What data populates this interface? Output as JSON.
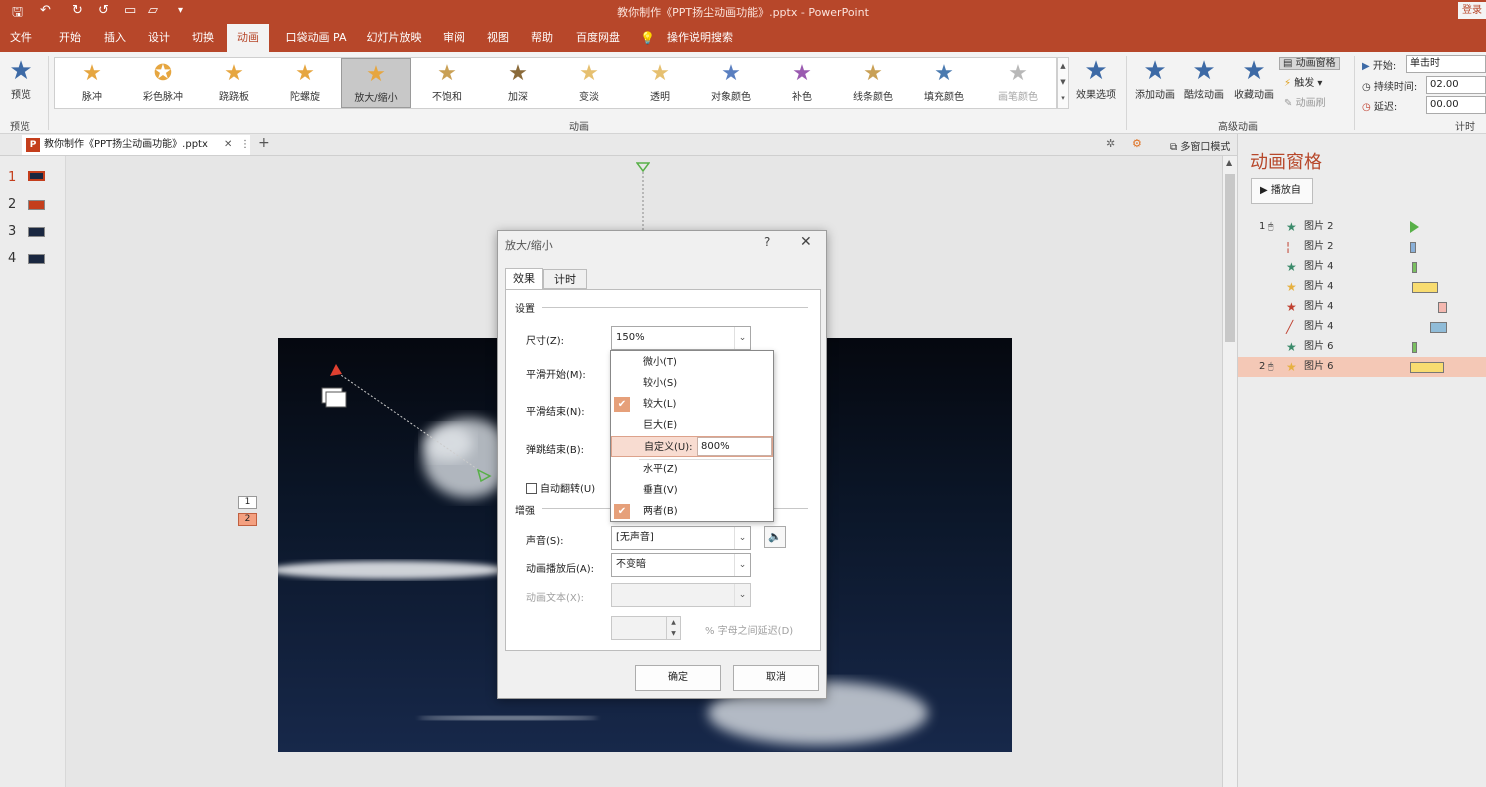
{
  "titlebar": {
    "title": "教你制作《PPT扬尘动画功能》.pptx  -  PowerPoint",
    "login": "登录",
    "qa_icons": [
      "save-icon",
      "undo-icon",
      "redo-icon",
      "repeat-icon",
      "new-icon",
      "open-icon",
      "customize-icon"
    ]
  },
  "menu_tabs": [
    "文件",
    "开始",
    "插入",
    "设计",
    "切换",
    "动画",
    "口袋动画 PA",
    "幻灯片放映",
    "审阅",
    "视图",
    "帮助",
    "百度网盘",
    "操作说明搜索"
  ],
  "active_tab": "动画",
  "ribbon": {
    "preview": {
      "label": "预览",
      "group": "预览"
    },
    "gallery": [
      {
        "label": "脉冲",
        "color": "#e6a640"
      },
      {
        "label": "彩色脉冲",
        "color": "#e6a640"
      },
      {
        "label": "跷跷板",
        "color": "#e6a640"
      },
      {
        "label": "陀螺旋",
        "color": "#e6a640"
      },
      {
        "label": "放大/缩小",
        "color": "#e6a640"
      },
      {
        "label": "不饱和",
        "color": "#c9a055"
      },
      {
        "label": "加深",
        "color": "#8a6a3a"
      },
      {
        "label": "变淡",
        "color": "#e6c070"
      },
      {
        "label": "透明",
        "color": "#e6c070"
      },
      {
        "label": "对象颜色",
        "color": "#5a7fc0"
      },
      {
        "label": "补色",
        "color": "#9a5ab0"
      },
      {
        "label": "线条颜色",
        "color": "#c9a055"
      },
      {
        "label": "填充颜色",
        "color": "#4a7ab0"
      },
      {
        "label": "画笔颜色",
        "color": "#b8b8b8"
      }
    ],
    "selected_gallery": "放大/缩小",
    "effect_options": "效果选项",
    "group_animation": "动画",
    "add_animation": "添加动画",
    "cool_animation": "酷炫动画",
    "collect_animation": "收藏动画",
    "animation_pane_btn": "动画窗格",
    "trigger": "触发",
    "animation_painter": "动画刷",
    "group_advanced": "高级动画",
    "start_label": "开始:",
    "start_value": "单击时",
    "duration_label": "持续时间:",
    "duration_value": "02.00",
    "delay_label": "延迟:",
    "delay_value": "00.00",
    "group_timing": "计时"
  },
  "docbar": {
    "doc_tab": "教你制作《PPT扬尘动画功能》.pptx",
    "multi_window": "多窗口模式"
  },
  "thumbnails": [
    "1",
    "2",
    "3",
    "4"
  ],
  "slide_tags": [
    "1",
    "2"
  ],
  "anim_pane": {
    "title": "动画窗格",
    "play_button": "播放自",
    "rows": [
      {
        "index": "1",
        "star": "★",
        "star_color": "#3a8a6a",
        "name": "图片 2",
        "bar_color": "#58b048",
        "bar_type": "triangle"
      },
      {
        "index": "",
        "star": "¦",
        "star_color": "#c04030",
        "name": "图片 2",
        "bar_color": "#8ab0d8",
        "bar_type": "bar"
      },
      {
        "index": "",
        "star": "★",
        "star_color": "#3a8a6a",
        "name": "图片 4",
        "bar_color": "#7ac060",
        "bar_type": "bar"
      },
      {
        "index": "",
        "star": "★",
        "star_color": "#e6b040",
        "name": "图片 4",
        "bar_color": "#f8dc70",
        "bar_type": "bar"
      },
      {
        "index": "",
        "star": "★",
        "star_color": "#c04030",
        "name": "图片 4",
        "bar_color": "#f4b8b0",
        "bar_type": "bar"
      },
      {
        "index": "",
        "star": "╱",
        "star_color": "#c04030",
        "name": "图片 4",
        "bar_color": "#90bcd8",
        "bar_type": "bar"
      },
      {
        "index": "",
        "star": "★",
        "star_color": "#3a8a6a",
        "name": "图片 6",
        "bar_color": "#7ac060",
        "bar_type": "bar"
      },
      {
        "index": "2",
        "star": "★",
        "star_color": "#e6b040",
        "name": "图片 6",
        "bar_color": "#f8dc70",
        "bar_type": "bar"
      }
    ]
  },
  "dialog": {
    "title": "放大/缩小",
    "help": "?",
    "close": "✕",
    "tabs": [
      "效果",
      "计时"
    ],
    "settings_section": "设置",
    "size_label": "尺寸(Z):",
    "size_value": "150%",
    "smooth_start_label": "平滑开始(M):",
    "smooth_end_label": "平滑结束(N):",
    "bounce_end_label": "弹跳结束(B):",
    "auto_reverse_label": "自动翻转(U)",
    "enhance_section": "增强",
    "sound_label": "声音(S):",
    "sound_value": "[无声音]",
    "after_anim_label": "动画播放后(A):",
    "after_anim_value": "不变暗",
    "anim_text_label": "动画文本(X):",
    "delay_pct_label": "% 字母之间延迟(D)",
    "ok": "确定",
    "cancel": "取消"
  },
  "size_dropdown": {
    "items": [
      {
        "label": "微小(T)",
        "checked": false
      },
      {
        "label": "较小(S)",
        "checked": false
      },
      {
        "label": "较大(L)",
        "checked": true
      },
      {
        "label": "巨大(E)",
        "checked": false
      },
      {
        "label": "自定义(U):",
        "checked": false,
        "highlight": true,
        "input": "800%"
      },
      {
        "label": "水平(Z)",
        "checked": false
      },
      {
        "label": "垂直(V)",
        "checked": false
      },
      {
        "label": "两者(B)",
        "checked": true
      }
    ]
  },
  "colors": {
    "accent": "#b7472a",
    "selected_row": "#f4c8b6",
    "check": "#e6a07a"
  }
}
